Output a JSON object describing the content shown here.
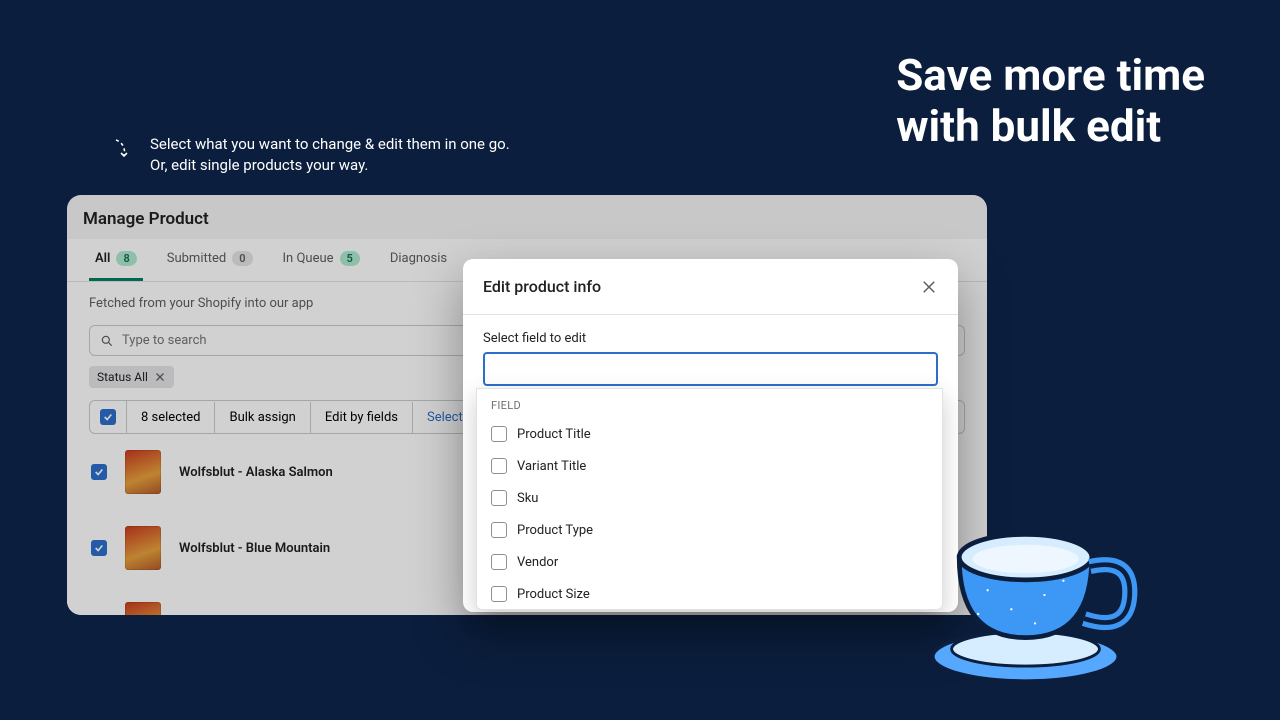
{
  "hero": {
    "line1": "Save more time",
    "line2": "with bulk edit"
  },
  "caption": {
    "line1": "Select what you want to change & edit them in one go.",
    "line2": "Or, edit single products your way."
  },
  "window": {
    "title": "Manage Product",
    "tabs": [
      {
        "label": "All",
        "count": "8",
        "active": true
      },
      {
        "label": "Submitted",
        "count": "0",
        "active": false,
        "grey": true
      },
      {
        "label": "In Queue",
        "count": "5",
        "active": false
      },
      {
        "label": "Diagnosis",
        "count": null,
        "active": false
      }
    ],
    "fetched_note": "Fetched from your Shopify into our app",
    "search_placeholder": "Type to search",
    "filter_chip": "Status All",
    "bulk": {
      "selected_text": "8 selected",
      "bulk_assign": "Bulk assign",
      "edit_by_fields": "Edit by fields",
      "select_all": "Select all products"
    },
    "products": [
      {
        "name": "Wolfsblut - Alaska Salmon"
      },
      {
        "name": "Wolfsblut - Blue Mountain"
      }
    ]
  },
  "modal": {
    "title": "Edit product info",
    "field_label": "Select field to edit",
    "group_label": "FIELD",
    "options": [
      "Product Title",
      "Variant Title",
      "Sku",
      "Product Type",
      "Vendor",
      "Product Size"
    ]
  }
}
